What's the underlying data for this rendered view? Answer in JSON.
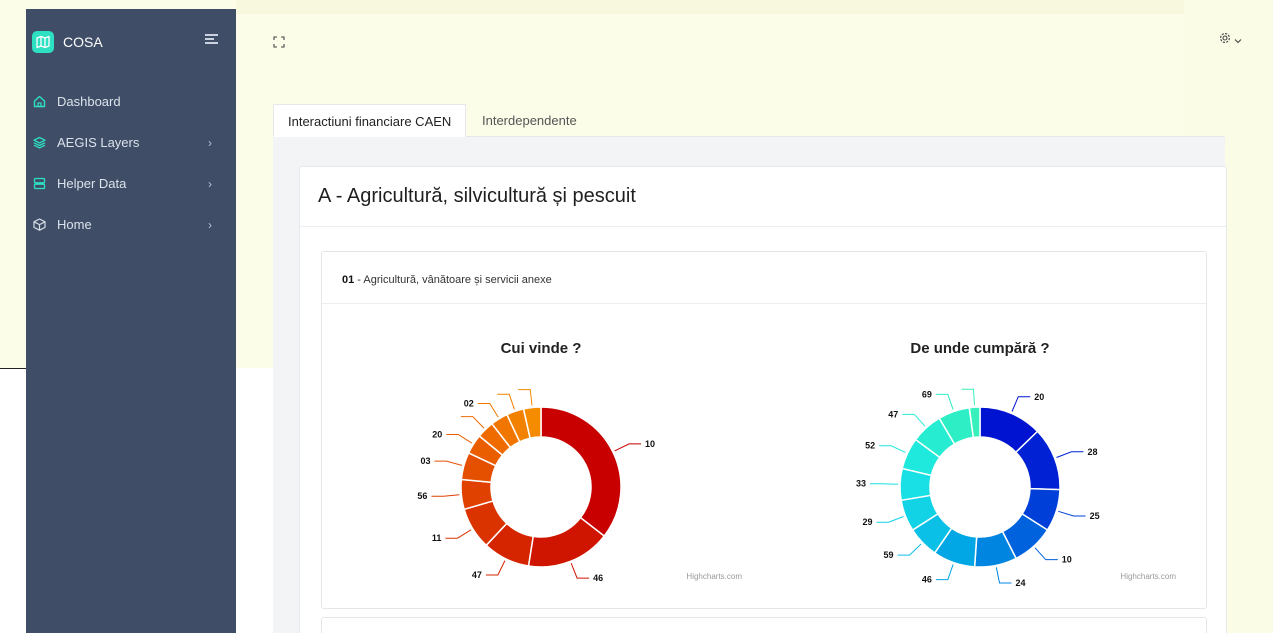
{
  "app": {
    "name": "COSA"
  },
  "sidebar": {
    "items": [
      {
        "label": "Dashboard",
        "icon": "home-icon",
        "has_children": false
      },
      {
        "label": "AEGIS Layers",
        "icon": "layers-icon",
        "has_children": true
      },
      {
        "label": "Helper Data",
        "icon": "server-icon",
        "has_children": true
      },
      {
        "label": "Home",
        "icon": "cube-icon",
        "has_children": true
      }
    ]
  },
  "tabs": [
    {
      "label": "Interactiuni financiare CAEN",
      "active": true
    },
    {
      "label": "Interdependente",
      "active": false
    }
  ],
  "section": {
    "title": "A - Agricultură, silvicultură și pescuit",
    "subsection": {
      "code": "01",
      "separator": " - ",
      "name": "Agricultură, vânătoare și servicii anexe"
    }
  },
  "colors": {
    "sidebar_bg": "#3f4e66",
    "accent": "#2ee0c2"
  },
  "chart_data": [
    {
      "type": "pie",
      "variant": "donut",
      "title": "Cui vinde ?",
      "credit": "Highcharts.com",
      "categories": [
        "10",
        "46",
        "47",
        "11",
        "56",
        "03",
        "20",
        "",
        "02",
        "",
        ""
      ],
      "values": [
        35.5,
        17.0,
        9.5,
        8.5,
        6.0,
        5.5,
        4.0,
        3.5,
        3.5,
        3.5,
        3.5
      ],
      "colors": [
        "#c80000",
        "#cf1500",
        "#d42400",
        "#db3300",
        "#e04000",
        "#e54f00",
        "#ea5e00",
        "#ef6b00",
        "#f17600",
        "#f38100",
        "#f58c00"
      ]
    },
    {
      "type": "pie",
      "variant": "donut",
      "title": "De unde cumpără ?",
      "credit": "Highcharts.com",
      "categories": [
        "20",
        "28",
        "25",
        "10",
        "24",
        "46",
        "59",
        "29",
        "33",
        "52",
        "47",
        "69",
        ""
      ],
      "values": [
        12,
        12,
        8,
        8,
        8,
        8,
        6,
        6,
        6,
        6,
        6,
        6,
        2
      ],
      "colors": [
        "#0013d1",
        "#0021d4",
        "#0040d8",
        "#0062dc",
        "#0085e0",
        "#00a7e4",
        "#0bc0e6",
        "#12d2e6",
        "#18e0e4",
        "#1fe8dc",
        "#26ecd2",
        "#2eeec6",
        "#38f0bc"
      ]
    }
  ]
}
